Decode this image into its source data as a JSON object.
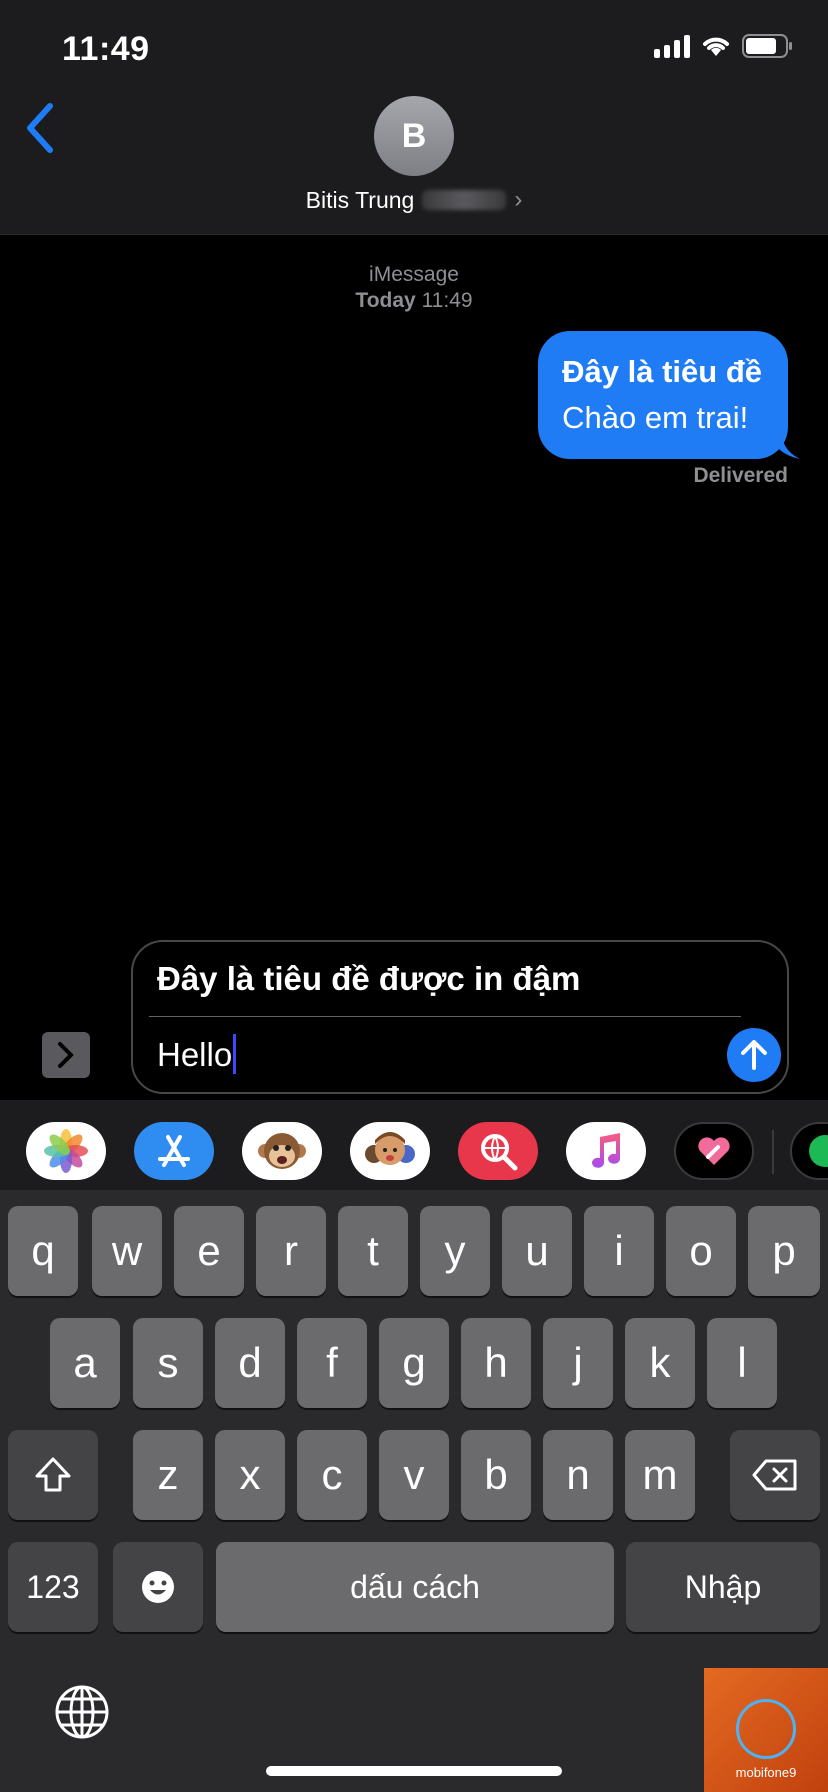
{
  "status_bar": {
    "time": "11:49"
  },
  "header": {
    "avatar_initial": "B",
    "contact_name": "Bitis Trung"
  },
  "conversation": {
    "service": "iMessage",
    "date_label": "Today",
    "time": "11:49",
    "message_subject": "Đây là tiêu đề",
    "message_body": "Chào em trai!",
    "status": "Delivered"
  },
  "composer": {
    "subject": "Đây là tiêu đề được in đậm",
    "text": "Hello"
  },
  "app_strip": [
    "photos-icon",
    "app-store-icon",
    "animoji-icon",
    "memoji-icon",
    "web-search-icon",
    "music-icon",
    "digital-touch-icon",
    "spotify-icon"
  ],
  "keyboard": {
    "row1": [
      "q",
      "w",
      "e",
      "r",
      "t",
      "y",
      "u",
      "i",
      "o",
      "p"
    ],
    "row2": [
      "a",
      "s",
      "d",
      "f",
      "g",
      "h",
      "j",
      "k",
      "l"
    ],
    "row3": [
      "z",
      "x",
      "c",
      "v",
      "b",
      "n",
      "m"
    ],
    "numbers_label": "123",
    "space_label": "dấu cách",
    "return_label": "Nhập"
  },
  "watermark": {
    "text": "mobifone9"
  },
  "colors": {
    "accent": "#1f7cf5",
    "background": "#000000",
    "keyboard": "#2a2a2c"
  }
}
